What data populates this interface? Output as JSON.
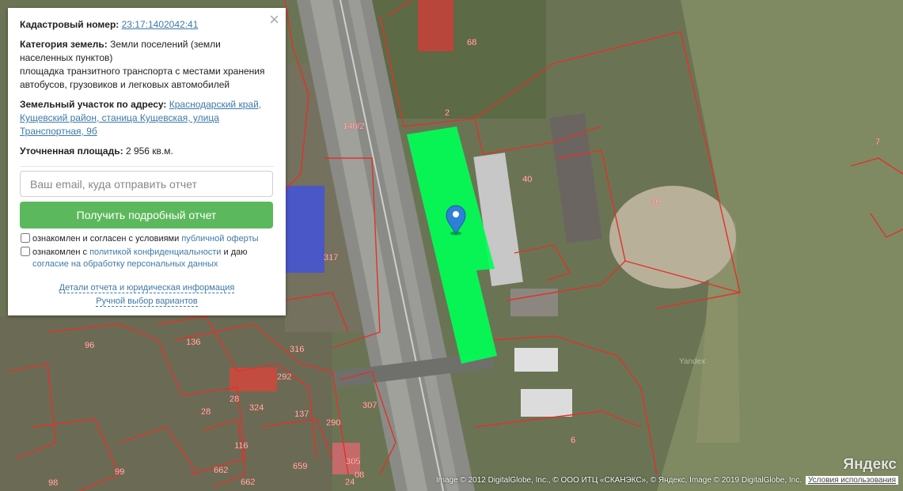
{
  "panel": {
    "cadastral_label": "Кадастровый номер:",
    "cadastral_number": "23:17:1402042:41",
    "category_label": "Категория земель:",
    "category_value": "Земли поселений (земли населенных пунктов)",
    "usage": "площадка транзитного транспорта с местами хранения автобусов, грузовиков и легковых автомобилей",
    "address_label": "Земельный участок по адресу:",
    "address": "Краснодарский край, Кущевский район, станица Кущевская, улица Транспортная, 9б",
    "area_label": "Уточненная площадь:",
    "area_value": "2 956 кв.м.",
    "email_placeholder": "Ваш email, куда отправить отчет",
    "submit_label": "Получить подробный отчет",
    "consent1_text": "ознакомлен и согласен с условиями",
    "consent1_link": "публичной оферты",
    "consent2_text": "ознакомлен с",
    "consent2_link": "политикой конфиденциальности",
    "consent2_mid": "и даю",
    "consent2_link2": "согласие на обработку персональных данных",
    "details_link": "Детали отчета и юридическая информация",
    "manual_link": "Ручной выбор вариантов",
    "close_symbol": "×"
  },
  "map": {
    "parcel_numbers": [
      "68",
      "2",
      "140/2",
      "40",
      "39",
      "7",
      "317",
      "136",
      "96",
      "316",
      "292",
      "28",
      "324",
      "137",
      "116",
      "290",
      "307",
      "6",
      "28",
      "305",
      "662",
      "659",
      "99",
      "98",
      "662",
      "24",
      "08"
    ],
    "watermark": "Yandex",
    "logo": "Яндекс",
    "attribution": "Image © 2012 DigitalGlobe, Inc., © ООО ИТЦ «СКАНЭКС», © Яндекс, Image © 2019 DigitalGlobe, Inc.",
    "terms_link": "Условия использования",
    "colors": {
      "selected_parcel": "#00ff55",
      "parcel_border": "#e0322a",
      "pin": "#2e7fd6",
      "submit_button": "#5cb85c",
      "link": "#3d79a8"
    }
  }
}
